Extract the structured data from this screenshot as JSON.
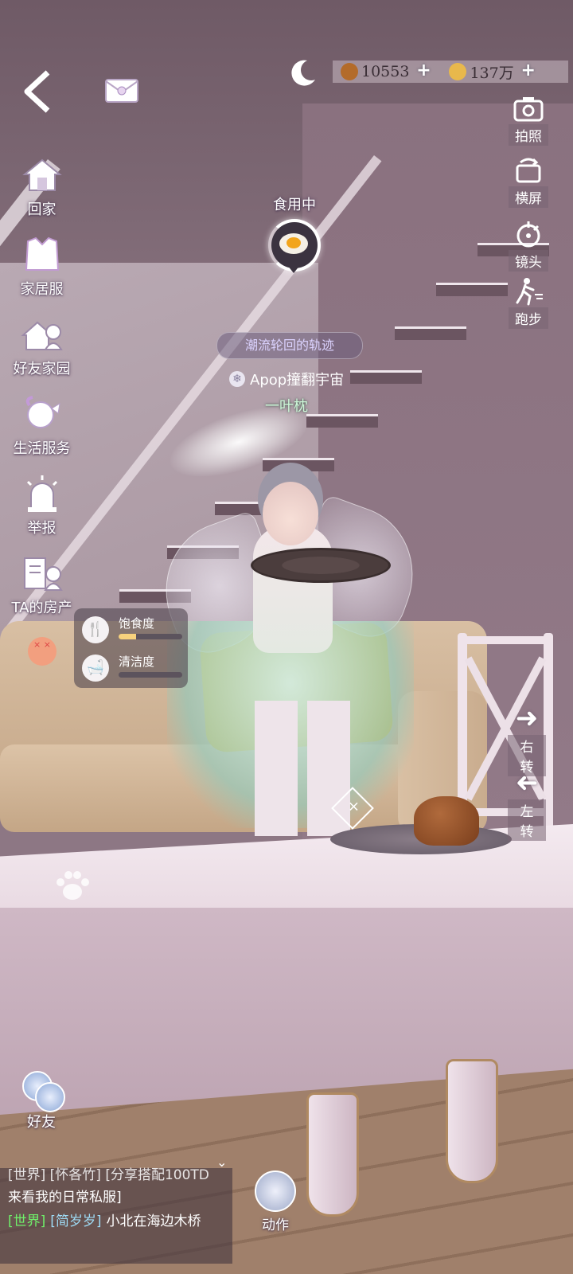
{
  "top": {
    "currency_1": "10553",
    "currency_2": "137万"
  },
  "left_menu": [
    {
      "icon": "home-icon",
      "label": "回家"
    },
    {
      "icon": "home-outfit-icon",
      "label": "家居服"
    },
    {
      "icon": "friend-home-icon",
      "label": "好友家园"
    },
    {
      "icon": "life-service-icon",
      "label": "生活服务"
    },
    {
      "icon": "report-alarm-icon",
      "label": "举报"
    },
    {
      "icon": "property-icon",
      "label": "TA的房产"
    }
  ],
  "right_menu": [
    {
      "icon": "camera-icon",
      "label": "拍照"
    },
    {
      "icon": "rotate-screen-icon",
      "label": "横屏"
    },
    {
      "icon": "lens-icon",
      "label": "镜头"
    },
    {
      "icon": "run-icon",
      "label": "跑步"
    }
  ],
  "eating": {
    "label": "食用中",
    "progress": 0.82
  },
  "player": {
    "title": "潮流轮回的轨迹",
    "name": "Apop撞翻宇宙",
    "subname": "一叶枕"
  },
  "status": {
    "satiety_label": "饱食度",
    "satiety_value": 0.28,
    "clean_label": "清洁度",
    "clean_value": 0.0
  },
  "turn": {
    "right": "右转",
    "left": "左转"
  },
  "friend_label": "好友",
  "action_label": "动作",
  "chat": [
    {
      "text": "[世界] [怀各竹] [分享搭配100TD"
    },
    {
      "text": "来看我的日常私服]"
    },
    {
      "channel": "[世界]",
      "name": "[简岁岁]",
      "msg": "小北在海边木桥"
    }
  ],
  "colors": {
    "accent_green": "#6ff06a",
    "name_blue": "#9fdcf6",
    "bar_fill": "#f7d27d"
  }
}
